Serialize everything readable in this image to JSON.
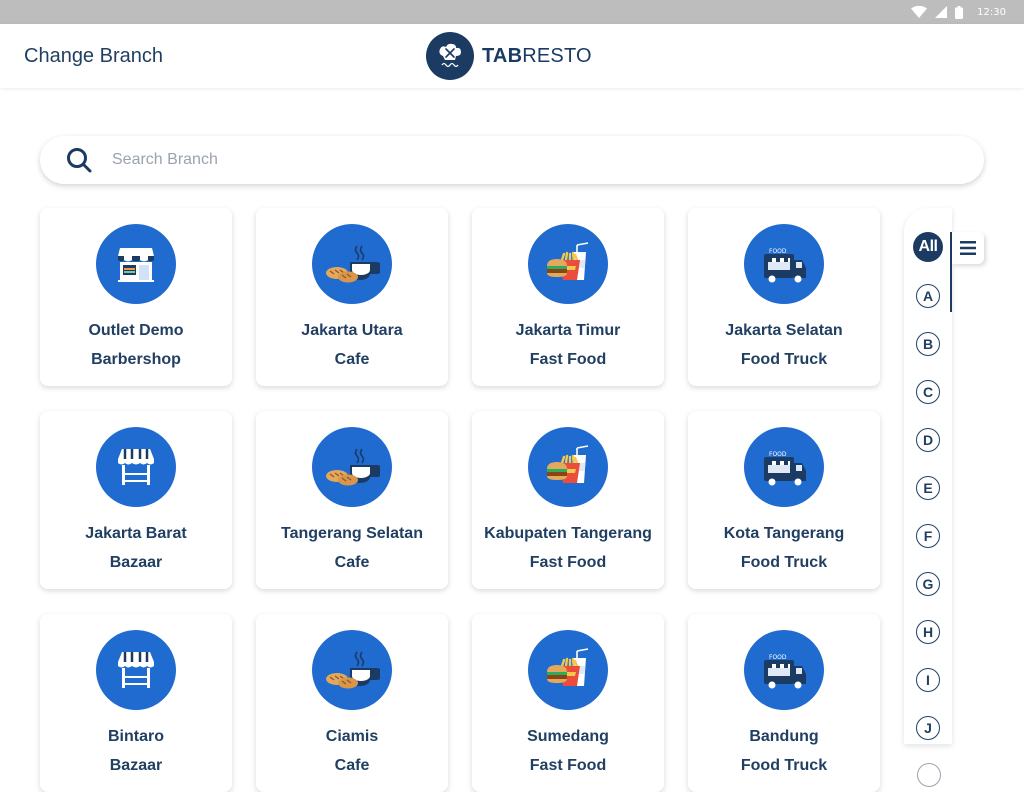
{
  "status_bar": {
    "time": "12:30"
  },
  "app_bar": {
    "title": "Change Branch",
    "brand_bold": "TAB",
    "brand_rest": "RESTO"
  },
  "search": {
    "placeholder": "Search Branch",
    "value": ""
  },
  "branches": [
    {
      "name": "Outlet Demo",
      "type": "Barbershop",
      "icon": "barbershop-icon"
    },
    {
      "name": "Jakarta Utara",
      "type": "Cafe",
      "icon": "cafe-icon"
    },
    {
      "name": "Jakarta Timur",
      "type": "Fast Food",
      "icon": "fast-food-icon"
    },
    {
      "name": "Jakarta Selatan",
      "type": "Food Truck",
      "icon": "food-truck-icon"
    },
    {
      "name": "Jakarta Barat",
      "type": "Bazaar",
      "icon": "bazaar-icon"
    },
    {
      "name": "Tangerang Selatan",
      "type": "Cafe",
      "icon": "cafe-icon"
    },
    {
      "name": "Kabupaten Tangerang",
      "type": "Fast Food",
      "icon": "fast-food-icon"
    },
    {
      "name": "Kota Tangerang",
      "type": "Food Truck",
      "icon": "food-truck-icon"
    },
    {
      "name": "Bintaro",
      "type": "Bazaar",
      "icon": "bazaar-icon"
    },
    {
      "name": "Ciamis",
      "type": "Cafe",
      "icon": "cafe-icon"
    },
    {
      "name": "Sumedang",
      "type": "Fast Food",
      "icon": "fast-food-icon"
    },
    {
      "name": "Bandung",
      "type": "Food Truck",
      "icon": "food-truck-icon"
    }
  ],
  "alphabet": {
    "all_label": "All",
    "letters": [
      "A",
      "B",
      "C",
      "D",
      "E",
      "F",
      "G",
      "H",
      "I",
      "J"
    ]
  },
  "colors": {
    "primary": "#1b3b63",
    "icon_bg": "#1f6bd0",
    "text": "#213f62",
    "truck_text": "FOOD"
  }
}
